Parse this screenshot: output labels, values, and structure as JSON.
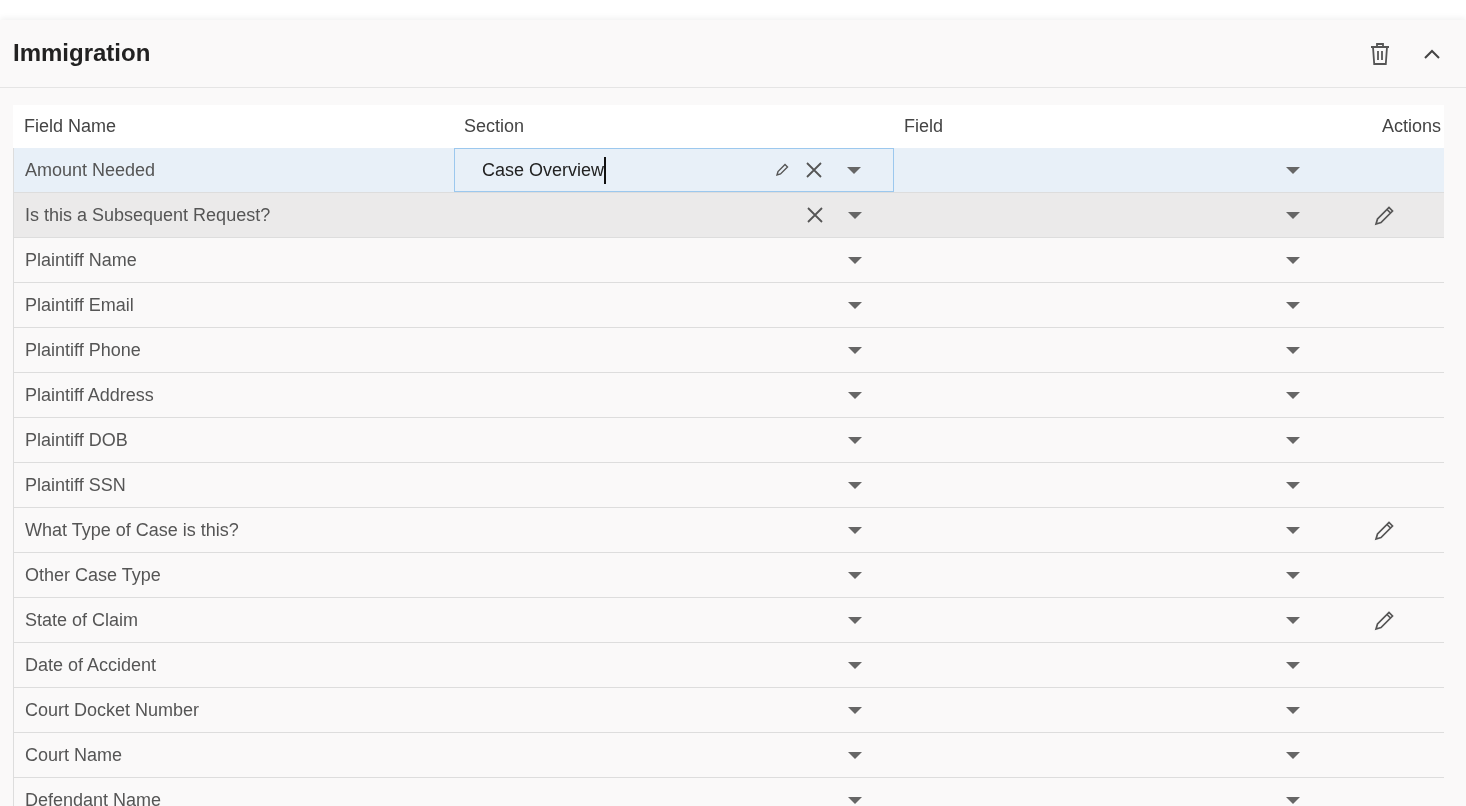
{
  "panel": {
    "title": "Immigration"
  },
  "table": {
    "columns": [
      "Field Name",
      "Section",
      "Field",
      "Actions"
    ],
    "rows": [
      {
        "field_name": "Amount Needed",
        "selected": true,
        "hovered": false,
        "section": {
          "value": "Case Overview",
          "focused": true,
          "clearable": true
        },
        "editable": false
      },
      {
        "field_name": "Is this a Subsequent Request?",
        "selected": false,
        "hovered": true,
        "section": {
          "focused": false,
          "clearable": true
        },
        "editable": true
      },
      {
        "field_name": "Plaintiff Name",
        "selected": false,
        "hovered": false,
        "section": {
          "focused": false,
          "clearable": false
        },
        "editable": false
      },
      {
        "field_name": "Plaintiff Email",
        "selected": false,
        "hovered": false,
        "section": {
          "focused": false,
          "clearable": false
        },
        "editable": false
      },
      {
        "field_name": "Plaintiff Phone",
        "selected": false,
        "hovered": false,
        "section": {
          "focused": false,
          "clearable": false
        },
        "editable": false
      },
      {
        "field_name": "Plaintiff Address",
        "selected": false,
        "hovered": false,
        "section": {
          "focused": false,
          "clearable": false
        },
        "editable": false
      },
      {
        "field_name": "Plaintiff DOB",
        "selected": false,
        "hovered": false,
        "section": {
          "focused": false,
          "clearable": false
        },
        "editable": false
      },
      {
        "field_name": "Plaintiff SSN",
        "selected": false,
        "hovered": false,
        "section": {
          "focused": false,
          "clearable": false
        },
        "editable": false
      },
      {
        "field_name": "What Type of Case is this?",
        "selected": false,
        "hovered": false,
        "section": {
          "focused": false,
          "clearable": false
        },
        "editable": true
      },
      {
        "field_name": "Other Case Type",
        "selected": false,
        "hovered": false,
        "section": {
          "focused": false,
          "clearable": false
        },
        "editable": false
      },
      {
        "field_name": "State of Claim",
        "selected": false,
        "hovered": false,
        "section": {
          "focused": false,
          "clearable": false
        },
        "editable": true
      },
      {
        "field_name": "Date of Accident",
        "selected": false,
        "hovered": false,
        "section": {
          "focused": false,
          "clearable": false
        },
        "editable": false
      },
      {
        "field_name": "Court Docket Number",
        "selected": false,
        "hovered": false,
        "section": {
          "focused": false,
          "clearable": false
        },
        "editable": false
      },
      {
        "field_name": "Court Name",
        "selected": false,
        "hovered": false,
        "section": {
          "focused": false,
          "clearable": false
        },
        "editable": false
      },
      {
        "field_name": "Defendant Name",
        "selected": false,
        "hovered": false,
        "section": {
          "focused": false,
          "clearable": false
        },
        "editable": false
      }
    ]
  }
}
